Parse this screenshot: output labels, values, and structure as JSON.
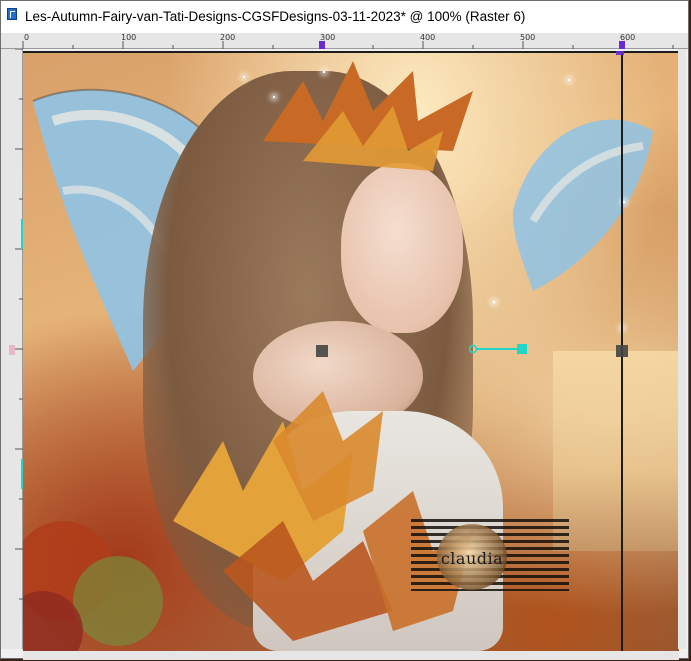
{
  "window": {
    "title": "Les-Autumn-Fairy-van-Tati-Designs-CGSFDesigns-03-11-2023* @ 100% (Raster 6)"
  },
  "ruler": {
    "labels": [
      "0",
      "100",
      "200",
      "300",
      "400",
      "500",
      "600"
    ]
  },
  "watermark": {
    "text": "claudia"
  },
  "icons": {
    "app": "app-icon",
    "move_handle": "move-handle-icon",
    "pivot": "pivot-icon"
  },
  "colors": {
    "titlebar_bg": "#ffffff",
    "ruler_bg": "#e6e6e6",
    "guide": "#1c1c1c",
    "accent_cyan": "#21d6c8",
    "accent_purple": "#6a2bd6"
  }
}
